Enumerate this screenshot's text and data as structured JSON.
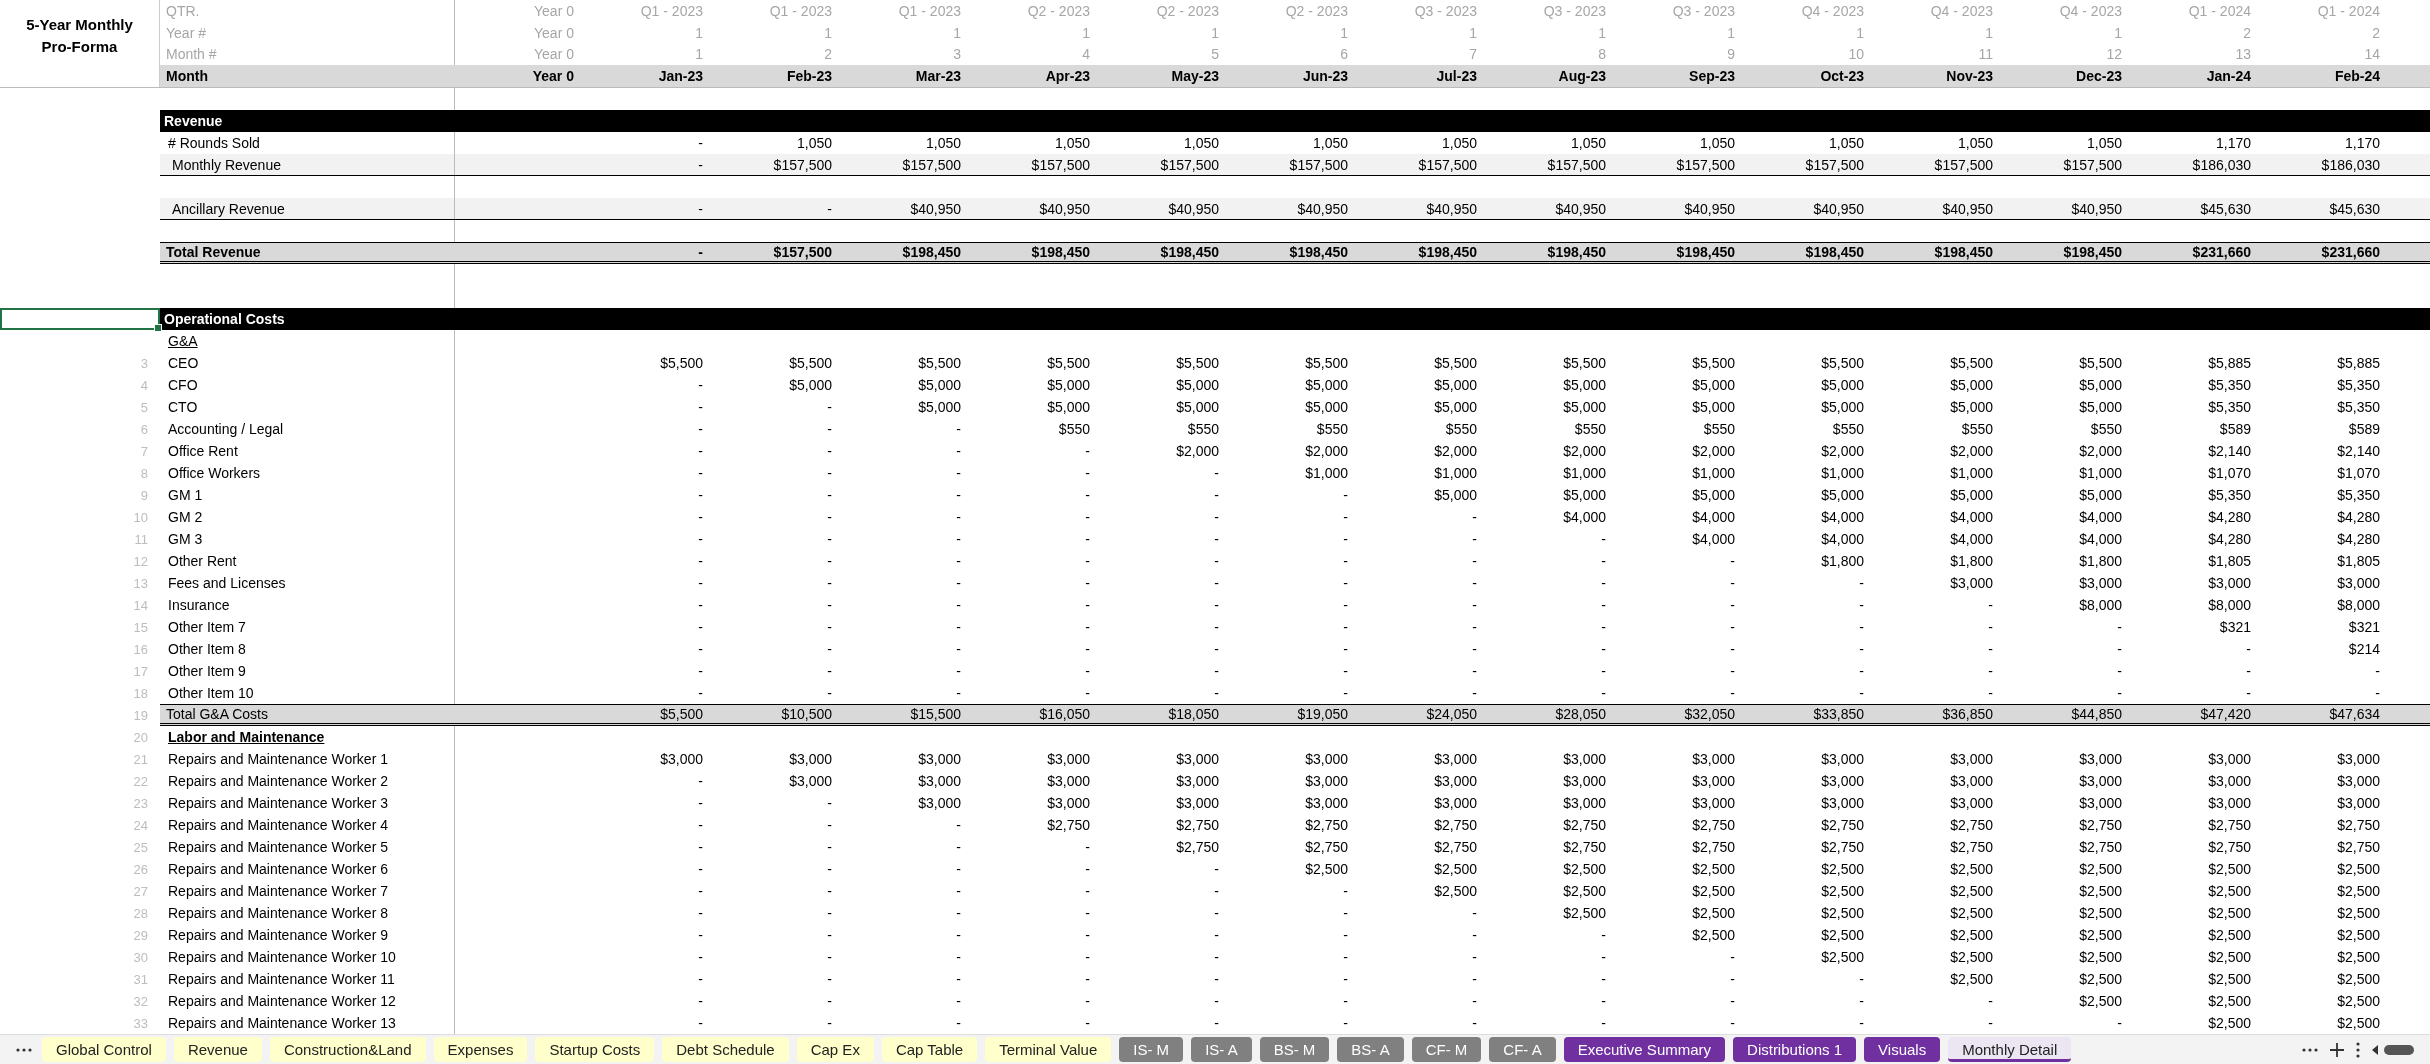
{
  "header": {
    "title": "5-Year Monthly Pro-Forma",
    "rows": [
      {
        "kind": "meta",
        "label": "QTR.",
        "cells": [
          "Year 0",
          "Q1 - 2023",
          "Q1 - 2023",
          "Q1 - 2023",
          "Q2 - 2023",
          "Q2 - 2023",
          "Q2 - 2023",
          "Q3 - 2023",
          "Q3 - 2023",
          "Q3 - 2023",
          "Q4 - 2023",
          "Q4 - 2023",
          "Q4 - 2023",
          "Q1 - 2024",
          "Q1 - 2024"
        ]
      },
      {
        "kind": "meta",
        "label": "Year #",
        "cells": [
          "Year 0",
          "1",
          "1",
          "1",
          "1",
          "1",
          "1",
          "1",
          "1",
          "1",
          "1",
          "1",
          "1",
          "2",
          "2"
        ]
      },
      {
        "kind": "meta",
        "label": "Month #",
        "cells": [
          "Year 0",
          "1",
          "2",
          "3",
          "4",
          "5",
          "6",
          "7",
          "8",
          "9",
          "10",
          "11",
          "12",
          "13",
          "14"
        ]
      },
      {
        "kind": "month",
        "label": "Month",
        "cells": [
          "Year 0",
          "Jan-23",
          "Feb-23",
          "Mar-23",
          "Apr-23",
          "May-23",
          "Jun-23",
          "Jul-23",
          "Aug-23",
          "Sep-23",
          "Oct-23",
          "Nov-23",
          "Dec-23",
          "Jan-24",
          "Feb-24"
        ]
      }
    ]
  },
  "rows": [
    {
      "kind": "spacer",
      "selected": false
    },
    {
      "kind": "section",
      "label": "Revenue",
      "selected": false
    },
    {
      "kind": "item",
      "label": "# Rounds Sold",
      "selected": false,
      "values": [
        "-",
        "1,050",
        "1,050",
        "1,050",
        "1,050",
        "1,050",
        "1,050",
        "1,050",
        "1,050",
        "1,050",
        "1,050",
        "1,050",
        "1,170",
        "1,170"
      ]
    },
    {
      "kind": "shaded",
      "label": "Monthly Revenue",
      "selected": false,
      "values": [
        "-",
        "$157,500",
        "$157,500",
        "$157,500",
        "$157,500",
        "$157,500",
        "$157,500",
        "$157,500",
        "$157,500",
        "$157,500",
        "$157,500",
        "$157,500",
        "$186,030",
        "$186,030"
      ]
    },
    {
      "kind": "spacer",
      "selected": false
    },
    {
      "kind": "shaded",
      "label": "Ancillary Revenue",
      "selected": false,
      "values": [
        "-",
        "-",
        "$40,950",
        "$40,950",
        "$40,950",
        "$40,950",
        "$40,950",
        "$40,950",
        "$40,950",
        "$40,950",
        "$40,950",
        "$40,950",
        "$45,630",
        "$45,630"
      ]
    },
    {
      "kind": "spacer",
      "selected": false
    },
    {
      "kind": "total",
      "label": "Total Revenue",
      "bold": true,
      "selected": false,
      "values": [
        "-",
        "$157,500",
        "$198,450",
        "$198,450",
        "$198,450",
        "$198,450",
        "$198,450",
        "$198,450",
        "$198,450",
        "$198,450",
        "$198,450",
        "$198,450",
        "$231,660",
        "$231,660"
      ]
    },
    {
      "kind": "spacer",
      "selected": false
    },
    {
      "kind": "spacer",
      "selected": false
    },
    {
      "kind": "section",
      "label": "Operational Costs",
      "selected": true
    },
    {
      "kind": "subheader",
      "label": "G&A",
      "bold": false,
      "selected": false
    },
    {
      "kind": "item",
      "row_number": "3",
      "label": "CEO",
      "selected": false,
      "values": [
        "$5,500",
        "$5,500",
        "$5,500",
        "$5,500",
        "$5,500",
        "$5,500",
        "$5,500",
        "$5,500",
        "$5,500",
        "$5,500",
        "$5,500",
        "$5,500",
        "$5,885",
        "$5,885"
      ]
    },
    {
      "kind": "item",
      "row_number": "4",
      "label": "CFO",
      "selected": false,
      "values": [
        "-",
        "$5,000",
        "$5,000",
        "$5,000",
        "$5,000",
        "$5,000",
        "$5,000",
        "$5,000",
        "$5,000",
        "$5,000",
        "$5,000",
        "$5,000",
        "$5,350",
        "$5,350"
      ]
    },
    {
      "kind": "item",
      "row_number": "5",
      "label": "CTO",
      "selected": false,
      "values": [
        "-",
        "-",
        "$5,000",
        "$5,000",
        "$5,000",
        "$5,000",
        "$5,000",
        "$5,000",
        "$5,000",
        "$5,000",
        "$5,000",
        "$5,000",
        "$5,350",
        "$5,350"
      ]
    },
    {
      "kind": "item",
      "row_number": "6",
      "label": "Accounting / Legal",
      "selected": false,
      "values": [
        "-",
        "-",
        "-",
        "$550",
        "$550",
        "$550",
        "$550",
        "$550",
        "$550",
        "$550",
        "$550",
        "$550",
        "$589",
        "$589"
      ]
    },
    {
      "kind": "item",
      "row_number": "7",
      "label": "Office Rent",
      "selected": false,
      "values": [
        "-",
        "-",
        "-",
        "-",
        "$2,000",
        "$2,000",
        "$2,000",
        "$2,000",
        "$2,000",
        "$2,000",
        "$2,000",
        "$2,000",
        "$2,140",
        "$2,140"
      ]
    },
    {
      "kind": "item",
      "row_number": "8",
      "label": "Office Workers",
      "selected": false,
      "values": [
        "-",
        "-",
        "-",
        "-",
        "-",
        "$1,000",
        "$1,000",
        "$1,000",
        "$1,000",
        "$1,000",
        "$1,000",
        "$1,000",
        "$1,070",
        "$1,070"
      ]
    },
    {
      "kind": "item",
      "row_number": "9",
      "label": "GM 1",
      "selected": false,
      "values": [
        "-",
        "-",
        "-",
        "-",
        "-",
        "-",
        "$5,000",
        "$5,000",
        "$5,000",
        "$5,000",
        "$5,000",
        "$5,000",
        "$5,350",
        "$5,350"
      ]
    },
    {
      "kind": "item",
      "row_number": "10",
      "label": "GM 2",
      "selected": false,
      "values": [
        "-",
        "-",
        "-",
        "-",
        "-",
        "-",
        "-",
        "$4,000",
        "$4,000",
        "$4,000",
        "$4,000",
        "$4,000",
        "$4,280",
        "$4,280"
      ]
    },
    {
      "kind": "item",
      "row_number": "11",
      "label": "GM 3",
      "selected": false,
      "values": [
        "-",
        "-",
        "-",
        "-",
        "-",
        "-",
        "-",
        "-",
        "$4,000",
        "$4,000",
        "$4,000",
        "$4,000",
        "$4,280",
        "$4,280"
      ]
    },
    {
      "kind": "item",
      "row_number": "12",
      "label": "Other Rent",
      "selected": false,
      "values": [
        "-",
        "-",
        "-",
        "-",
        "-",
        "-",
        "-",
        "-",
        "-",
        "$1,800",
        "$1,800",
        "$1,800",
        "$1,805",
        "$1,805"
      ]
    },
    {
      "kind": "item",
      "row_number": "13",
      "label": "Fees and Licenses",
      "selected": false,
      "values": [
        "-",
        "-",
        "-",
        "-",
        "-",
        "-",
        "-",
        "-",
        "-",
        "-",
        "$3,000",
        "$3,000",
        "$3,000",
        "$3,000"
      ]
    },
    {
      "kind": "item",
      "row_number": "14",
      "label": "Insurance",
      "selected": false,
      "values": [
        "-",
        "-",
        "-",
        "-",
        "-",
        "-",
        "-",
        "-",
        "-",
        "-",
        "-",
        "$8,000",
        "$8,000",
        "$8,000"
      ]
    },
    {
      "kind": "item",
      "row_number": "15",
      "label": "Other Item 7",
      "selected": false,
      "values": [
        "-",
        "-",
        "-",
        "-",
        "-",
        "-",
        "-",
        "-",
        "-",
        "-",
        "-",
        "-",
        "$321",
        "$321"
      ]
    },
    {
      "kind": "item",
      "row_number": "16",
      "label": "Other Item 8",
      "selected": false,
      "values": [
        "-",
        "-",
        "-",
        "-",
        "-",
        "-",
        "-",
        "-",
        "-",
        "-",
        "-",
        "-",
        "-",
        "$214"
      ]
    },
    {
      "kind": "item",
      "row_number": "17",
      "label": "Other Item 9",
      "selected": false,
      "values": [
        "-",
        "-",
        "-",
        "-",
        "-",
        "-",
        "-",
        "-",
        "-",
        "-",
        "-",
        "-",
        "-",
        "-"
      ]
    },
    {
      "kind": "item",
      "row_number": "18",
      "label": "Other Item 10",
      "selected": false,
      "values": [
        "-",
        "-",
        "-",
        "-",
        "-",
        "-",
        "-",
        "-",
        "-",
        "-",
        "-",
        "-",
        "-",
        "-"
      ]
    },
    {
      "kind": "total",
      "row_number": "19",
      "label": "Total G&A Costs",
      "bold": false,
      "selected": false,
      "values": [
        "$5,500",
        "$10,500",
        "$15,500",
        "$16,050",
        "$18,050",
        "$19,050",
        "$24,050",
        "$28,050",
        "$32,050",
        "$33,850",
        "$36,850",
        "$44,850",
        "$47,420",
        "$47,634"
      ]
    },
    {
      "kind": "subheader",
      "row_number": "20",
      "label": "Labor and Maintenance",
      "bold": true,
      "selected": false
    },
    {
      "kind": "item",
      "row_number": "21",
      "label": "Repairs and Maintenance Worker 1",
      "selected": false,
      "values": [
        "$3,000",
        "$3,000",
        "$3,000",
        "$3,000",
        "$3,000",
        "$3,000",
        "$3,000",
        "$3,000",
        "$3,000",
        "$3,000",
        "$3,000",
        "$3,000",
        "$3,000",
        "$3,000"
      ]
    },
    {
      "kind": "item",
      "row_number": "22",
      "label": "Repairs and Maintenance Worker 2",
      "selected": false,
      "values": [
        "-",
        "$3,000",
        "$3,000",
        "$3,000",
        "$3,000",
        "$3,000",
        "$3,000",
        "$3,000",
        "$3,000",
        "$3,000",
        "$3,000",
        "$3,000",
        "$3,000",
        "$3,000"
      ]
    },
    {
      "kind": "item",
      "row_number": "23",
      "label": "Repairs and Maintenance Worker 3",
      "selected": false,
      "values": [
        "-",
        "-",
        "$3,000",
        "$3,000",
        "$3,000",
        "$3,000",
        "$3,000",
        "$3,000",
        "$3,000",
        "$3,000",
        "$3,000",
        "$3,000",
        "$3,000",
        "$3,000"
      ]
    },
    {
      "kind": "item",
      "row_number": "24",
      "label": "Repairs and Maintenance Worker 4",
      "selected": false,
      "values": [
        "-",
        "-",
        "-",
        "$2,750",
        "$2,750",
        "$2,750",
        "$2,750",
        "$2,750",
        "$2,750",
        "$2,750",
        "$2,750",
        "$2,750",
        "$2,750",
        "$2,750"
      ]
    },
    {
      "kind": "item",
      "row_number": "25",
      "label": "Repairs and Maintenance Worker 5",
      "selected": false,
      "values": [
        "-",
        "-",
        "-",
        "-",
        "$2,750",
        "$2,750",
        "$2,750",
        "$2,750",
        "$2,750",
        "$2,750",
        "$2,750",
        "$2,750",
        "$2,750",
        "$2,750"
      ]
    },
    {
      "kind": "item",
      "row_number": "26",
      "label": "Repairs and Maintenance Worker 6",
      "selected": false,
      "values": [
        "-",
        "-",
        "-",
        "-",
        "-",
        "$2,500",
        "$2,500",
        "$2,500",
        "$2,500",
        "$2,500",
        "$2,500",
        "$2,500",
        "$2,500",
        "$2,500"
      ]
    },
    {
      "kind": "item",
      "row_number": "27",
      "label": "Repairs and Maintenance Worker 7",
      "selected": false,
      "values": [
        "-",
        "-",
        "-",
        "-",
        "-",
        "-",
        "$2,500",
        "$2,500",
        "$2,500",
        "$2,500",
        "$2,500",
        "$2,500",
        "$2,500",
        "$2,500"
      ]
    },
    {
      "kind": "item",
      "row_number": "28",
      "label": "Repairs and Maintenance Worker 8",
      "selected": false,
      "values": [
        "-",
        "-",
        "-",
        "-",
        "-",
        "-",
        "-",
        "$2,500",
        "$2,500",
        "$2,500",
        "$2,500",
        "$2,500",
        "$2,500",
        "$2,500"
      ]
    },
    {
      "kind": "item",
      "row_number": "29",
      "label": "Repairs and Maintenance Worker 9",
      "selected": false,
      "values": [
        "-",
        "-",
        "-",
        "-",
        "-",
        "-",
        "-",
        "-",
        "$2,500",
        "$2,500",
        "$2,500",
        "$2,500",
        "$2,500",
        "$2,500"
      ]
    },
    {
      "kind": "item",
      "row_number": "30",
      "label": "Repairs and Maintenance Worker 10",
      "selected": false,
      "values": [
        "-",
        "-",
        "-",
        "-",
        "-",
        "-",
        "-",
        "-",
        "-",
        "$2,500",
        "$2,500",
        "$2,500",
        "$2,500",
        "$2,500"
      ]
    },
    {
      "kind": "item",
      "row_number": "31",
      "label": "Repairs and Maintenance Worker 11",
      "selected": false,
      "values": [
        "-",
        "-",
        "-",
        "-",
        "-",
        "-",
        "-",
        "-",
        "-",
        "-",
        "$2,500",
        "$2,500",
        "$2,500",
        "$2,500"
      ]
    },
    {
      "kind": "item",
      "row_number": "32",
      "label": "Repairs and Maintenance Worker 12",
      "selected": false,
      "values": [
        "-",
        "-",
        "-",
        "-",
        "-",
        "-",
        "-",
        "-",
        "-",
        "-",
        "-",
        "$2,500",
        "$2,500",
        "$2,500"
      ]
    },
    {
      "kind": "item",
      "row_number": "33",
      "label": "Repairs and Maintenance Worker 13",
      "selected": false,
      "values": [
        "-",
        "-",
        "-",
        "-",
        "-",
        "-",
        "-",
        "-",
        "-",
        "-",
        "-",
        "-",
        "$2,500",
        "$2,500"
      ]
    }
  ],
  "sheet_tabs": [
    {
      "label": "Global Control",
      "color": "#ffffcc",
      "selected": false
    },
    {
      "label": "Revenue",
      "color": "#ffffcc",
      "selected": false
    },
    {
      "label": "Construction&Land",
      "color": "#ffffcc",
      "selected": false
    },
    {
      "label": "Expenses",
      "color": "#ffffcc",
      "selected": false
    },
    {
      "label": "Startup Costs",
      "color": "#ffffcc",
      "selected": false
    },
    {
      "label": "Debt Schedule",
      "color": "#ffffcc",
      "selected": false
    },
    {
      "label": "Cap Ex",
      "color": "#ffffcc",
      "selected": false
    },
    {
      "label": "Cap Table",
      "color": "#ffffcc",
      "selected": false
    },
    {
      "label": "Terminal Value",
      "color": "#ffffcc",
      "selected": false
    },
    {
      "label": "IS- M",
      "color": "#808080",
      "selected": false
    },
    {
      "label": "IS- A",
      "color": "#808080",
      "selected": false
    },
    {
      "label": "BS- M",
      "color": "#808080",
      "selected": false
    },
    {
      "label": "BS- A",
      "color": "#808080",
      "selected": false
    },
    {
      "label": "CF- M",
      "color": "#808080",
      "selected": false
    },
    {
      "label": "CF- A",
      "color": "#808080",
      "selected": false
    },
    {
      "label": "Executive Summary",
      "color": "#7030a0",
      "selected": false
    },
    {
      "label": "Distributions 1",
      "color": "#7030a0",
      "selected": false
    },
    {
      "label": "Visuals",
      "color": "#7030a0",
      "selected": false
    },
    {
      "label": "Monthly Detail",
      "color": "#7030a0",
      "selected": true
    }
  ]
}
